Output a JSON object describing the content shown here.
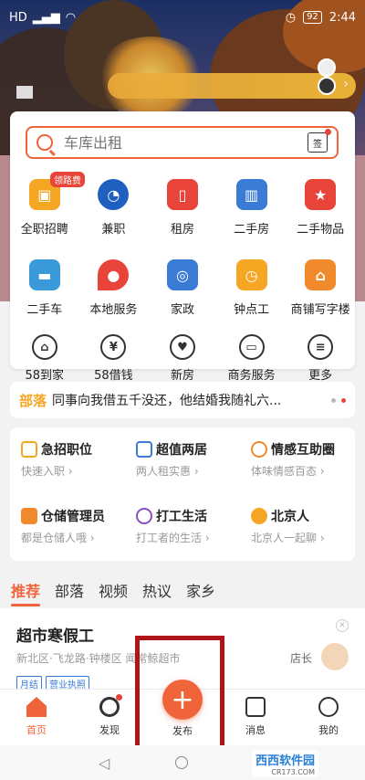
{
  "status_bar": {
    "network": "HD",
    "battery": "92",
    "time": "2:44"
  },
  "search": {
    "placeholder": "车库出租",
    "sign_label": "签"
  },
  "services": {
    "row1": [
      {
        "label": "全职招聘",
        "icon": "briefcase-icon",
        "color": "#f5a623",
        "tag": "领路费"
      },
      {
        "label": "兼职",
        "icon": "stopwatch-icon",
        "color": "#1f5fbf"
      },
      {
        "label": "租房",
        "icon": "rent-icon",
        "color": "#e8443a"
      },
      {
        "label": "二手房",
        "icon": "building-icon",
        "color": "#3a7bd5"
      },
      {
        "label": "二手物品",
        "icon": "star-bag-icon",
        "color": "#e8443a"
      }
    ],
    "row2": [
      {
        "label": "二手车",
        "icon": "car-icon",
        "color": "#3a9ad9"
      },
      {
        "label": "本地服务",
        "icon": "map-pin-icon",
        "color": "#e8443a"
      },
      {
        "label": "家政",
        "icon": "washer-icon",
        "color": "#3a7bd5"
      },
      {
        "label": "钟点工",
        "icon": "clock-worker-icon",
        "color": "#f5a623"
      },
      {
        "label": "商铺写字楼",
        "icon": "shop-icon",
        "color": "#f08a2c"
      }
    ],
    "row3": [
      {
        "label": "58到家",
        "icon": "house-58-icon"
      },
      {
        "label": "58借钱",
        "icon": "yen-icon"
      },
      {
        "label": "新房",
        "icon": "heart-house-icon"
      },
      {
        "label": "商务服务",
        "icon": "monitor-icon"
      },
      {
        "label": "更多",
        "icon": "more-icon"
      }
    ]
  },
  "news": {
    "badge": "部落",
    "text": "同事向我借五千没还，他结婚我随礼六..."
  },
  "features": [
    {
      "title": "急招职位",
      "sub": "快速入职",
      "color": "#f5a623"
    },
    {
      "title": "超值两居",
      "sub": "两人租实惠",
      "color": "#3a7bd5"
    },
    {
      "title": "情感互助圈",
      "sub": "体味情感百态",
      "color": "#f08a2c"
    },
    {
      "title": "仓储管理员",
      "sub": "都是仓储人哦",
      "color": "#f08a2c"
    },
    {
      "title": "打工生活",
      "sub": "打工者的生活",
      "color": "#8a4fc4"
    },
    {
      "title": "北京人",
      "sub": "北京人一起聊",
      "color": "#f5a623"
    }
  ],
  "feed_tabs": [
    "推荐",
    "部落",
    "视频",
    "热议",
    "家乡"
  ],
  "job": {
    "title": "超市寒假工",
    "location": "新北区·飞龙路·钟楼区",
    "employer_hidden": "闻常鲸超市",
    "role": "店长",
    "chips": [
      "月结",
      "营业执照"
    ]
  },
  "tabbar": {
    "home": "首页",
    "discover": "发现",
    "publish": "发布",
    "messages": "消息",
    "mine": "我的"
  },
  "watermark": {
    "brand": "西西软件园",
    "url": "CR173.COM"
  }
}
